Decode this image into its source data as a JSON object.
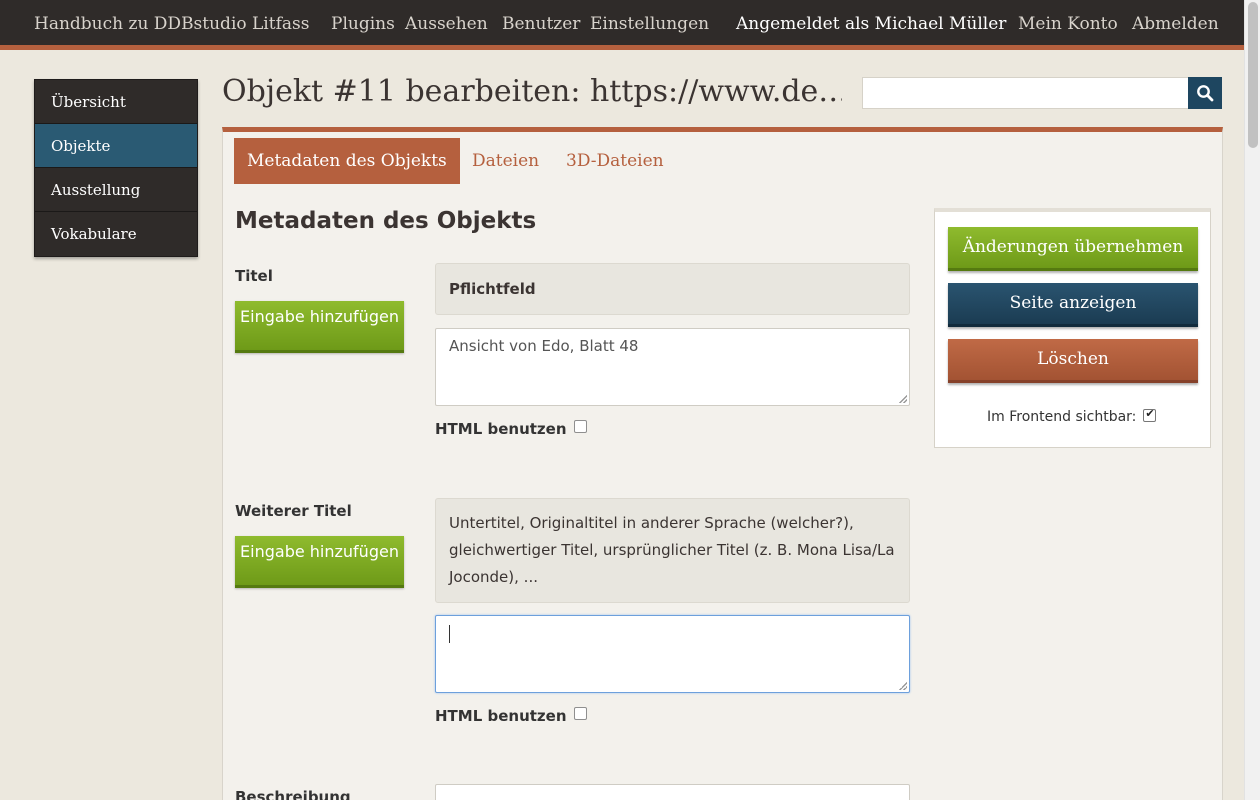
{
  "topbar": {
    "site_title": "Handbuch zu DDBstudio Litfass",
    "nav": [
      "Plugins",
      "Aussehen",
      "Benutzer",
      "Einstellungen"
    ],
    "logged_in": "Angemeldet als Michael Müller",
    "account": "Mein Konto",
    "logout": "Abmelden"
  },
  "sidebar": {
    "items": [
      {
        "label": "Übersicht",
        "active": false
      },
      {
        "label": "Objekte",
        "active": true
      },
      {
        "label": "Ausstellung",
        "active": false
      },
      {
        "label": "Vokabulare",
        "active": false
      }
    ]
  },
  "page": {
    "title": "Objekt #11 bearbeiten: https://www.de…"
  },
  "search": {
    "value": "",
    "icon": "search-icon"
  },
  "tabs": [
    {
      "label": "Metadaten des Objekts",
      "active": true
    },
    {
      "label": "Dateien",
      "active": false
    },
    {
      "label": "3D-Dateien",
      "active": false
    }
  ],
  "form": {
    "heading": "Metadaten des Objekts",
    "add_label": "Eingabe hinzufügen",
    "html_label": "HTML benutzen",
    "fields": [
      {
        "label": "Titel",
        "hint": "Pflichtfeld",
        "value": "Ansicht von Edo, Blatt 48",
        "html": false
      },
      {
        "label": "Weiterer Titel",
        "hint": "Untertitel, Originaltitel in anderer Sprache (welcher?), gleichwertiger Titel, ursprünglicher Titel (z. B. Mona Lisa/La Joconde), ...",
        "value": "",
        "html": false
      },
      {
        "label": "Beschreibung"
      }
    ]
  },
  "actions": {
    "save": "Änderungen übernehmen",
    "view": "Seite anzeigen",
    "delete": "Löschen",
    "public_label": "Im Frontend sichtbar:",
    "public_checked": true
  },
  "colors": {
    "accent": "#b5603e",
    "green": "#7aa51f",
    "blue": "#1e4660",
    "dark": "#2f2b29"
  }
}
